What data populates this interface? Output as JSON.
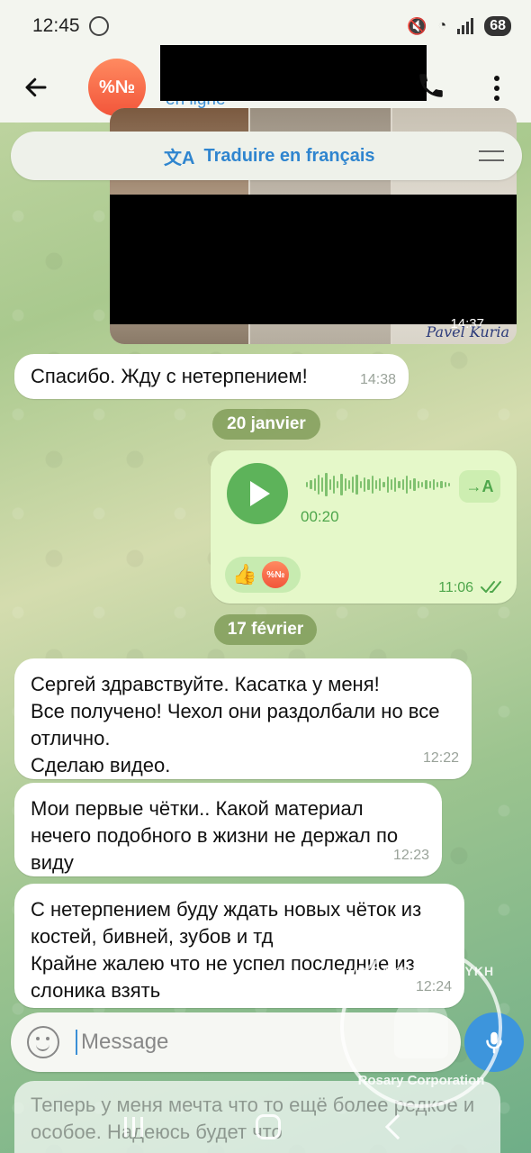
{
  "status_bar": {
    "time": "12:45",
    "battery": "68"
  },
  "header": {
    "avatar_text": "%№",
    "contact_status": "en ligne"
  },
  "translate_bar": {
    "icon": "文A",
    "label": "Traduire en français"
  },
  "photo_message": {
    "time": "14:37",
    "signature": "Pavel Kuria"
  },
  "messages": [
    {
      "text": "Спасибо. Жду с нетерпением!",
      "time": "14:38"
    },
    {
      "date": "20 janvier"
    },
    {
      "voice": {
        "duration": "00:20",
        "transcribe_label": "→A",
        "time": "11:06",
        "reactions": [
          "thumbs-up",
          "%№"
        ]
      }
    },
    {
      "date": "17 février"
    },
    {
      "text": "Сергей здравствуйте. Касатка у меня!\nВсе получено! Чехол они раздолбали но все отлично.\nСделаю видео.",
      "time": "12:22"
    },
    {
      "text": "Мои первые чётки.. Какой материал нечего подобного в жизни не держал по виду",
      "time": "12:23"
    },
    {
      "text": "С нетерпением буду ждать новых чёток из костей, бивней, зубов и тд\nКрайне жалею что не успел последние из слоника взять",
      "time": "12:24"
    },
    {
      "text": "Теперь у меня мечта что то ещё более редкое и особое. Надеюсь будет что"
    }
  ],
  "input_bar": {
    "placeholder": "Message"
  },
  "watermark": {
    "top_text": "VS BAKHTARTAVYKH",
    "bottom_text": "Rosary Corporation"
  },
  "colors": {
    "accent": "#3a8fd6",
    "outgoing_bubble": "#e5f8c9",
    "voice_green": "#5db35a",
    "avatar": "#f2553a"
  }
}
